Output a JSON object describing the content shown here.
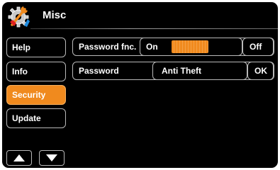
{
  "header": {
    "title": "Misc",
    "icon": "gear-wrench-icon"
  },
  "sidebar": {
    "items": [
      {
        "label": "Help",
        "active": false
      },
      {
        "label": "Info",
        "active": false
      },
      {
        "label": "Security",
        "active": true
      },
      {
        "label": "Update",
        "active": false
      }
    ],
    "up_icon": "up-arrow-icon",
    "down_icon": "down-arrow-icon"
  },
  "settings": {
    "password_function": {
      "label": "Password fnc.",
      "on_label": "On",
      "off_label": "Off",
      "state": "on"
    },
    "password": {
      "label": "Password",
      "value": "Anti Theft",
      "ok_label": "OK"
    }
  },
  "colors": {
    "accent": "#f08a1e",
    "background": "#000000",
    "border": "#b9b9b9"
  }
}
